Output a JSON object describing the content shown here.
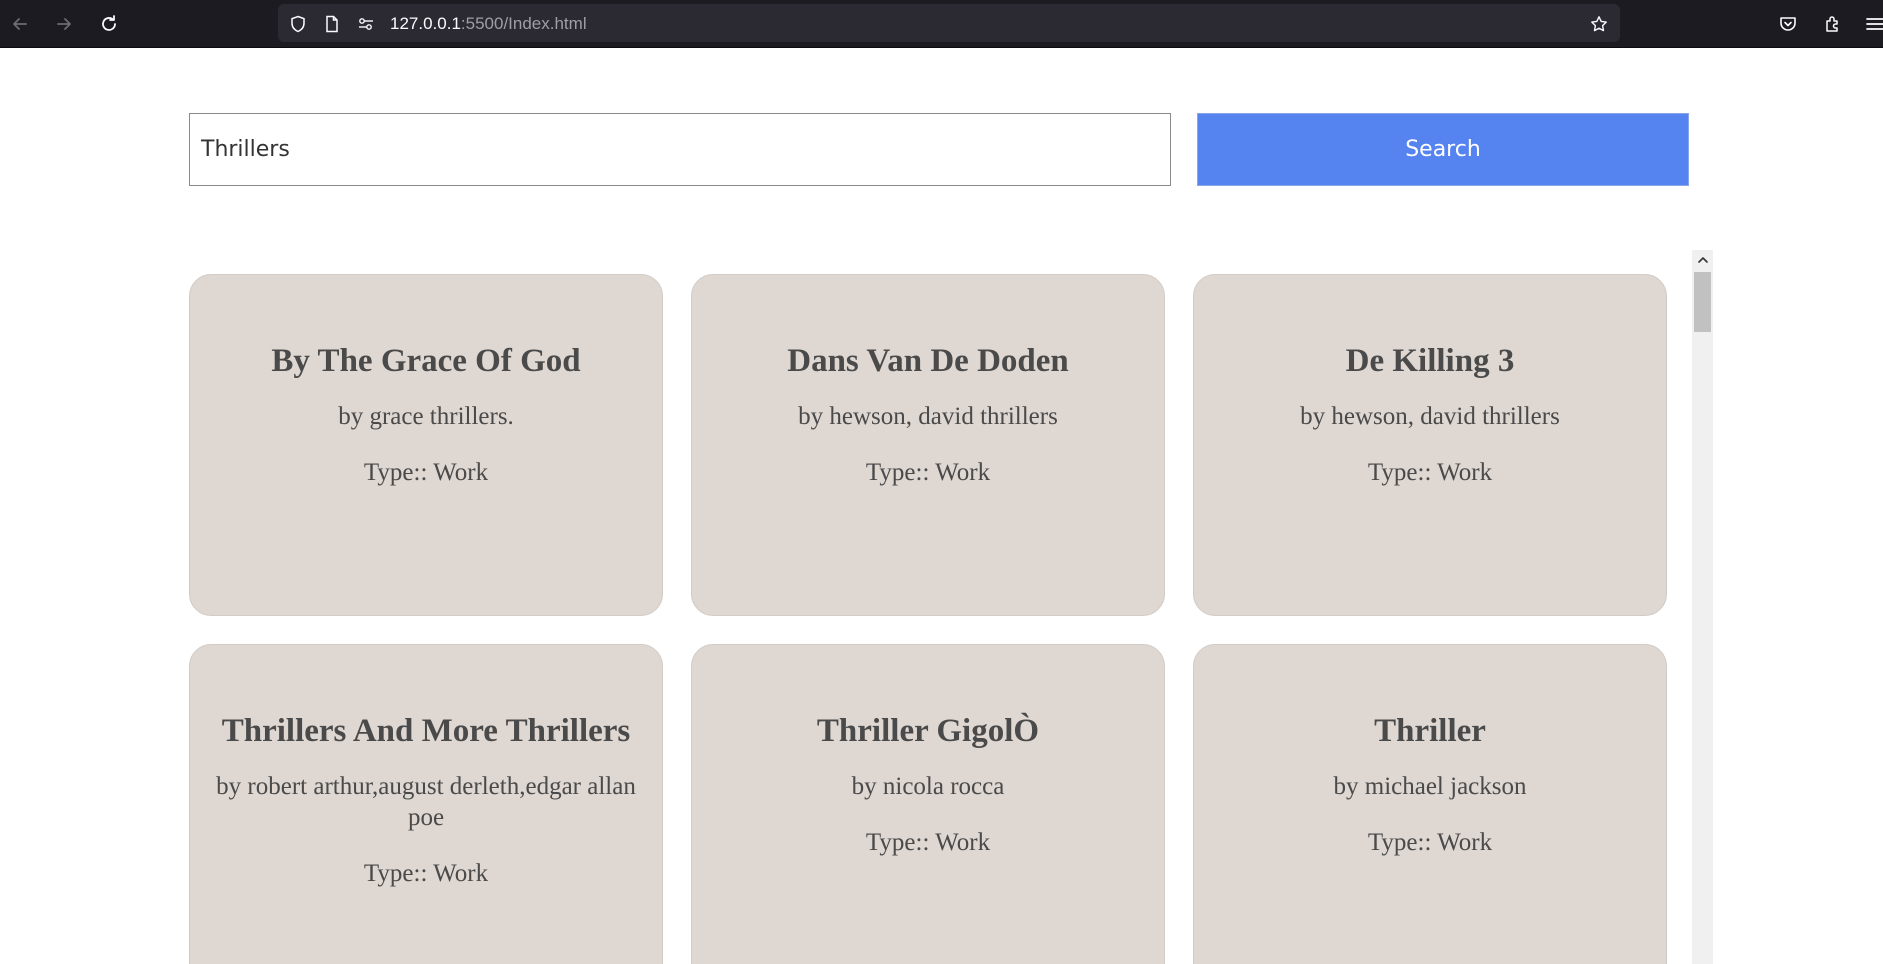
{
  "browser": {
    "url_host": "127.0.0.1",
    "url_path": ":5500/Index.html",
    "icons": [
      "back-arrow-icon",
      "forward-arrow-icon",
      "reload-icon",
      "shield-icon",
      "page-icon",
      "permissions-icon",
      "bookmark-star-icon",
      "pocket-icon",
      "extensions-icon",
      "menu-icon"
    ]
  },
  "search": {
    "value": "Thrillers",
    "button_label": "Search"
  },
  "results": [
    {
      "title": "By The Grace Of God",
      "author": "by grace thrillers.",
      "type": "Type:: Work"
    },
    {
      "title": "Dans Van De Doden",
      "author": "by hewson, david thrillers",
      "type": "Type:: Work"
    },
    {
      "title": "De Killing 3",
      "author": "by hewson, david thrillers",
      "type": "Type:: Work"
    },
    {
      "title": "Thrillers And More Thrillers",
      "author": "by robert arthur,august derleth,edgar allan poe",
      "type": "Type:: Work"
    },
    {
      "title": "Thriller GigolÒ",
      "author": "by nicola rocca",
      "type": "Type:: Work"
    },
    {
      "title": "Thriller",
      "author": "by michael jackson",
      "type": "Type:: Work"
    }
  ],
  "colors": {
    "toolbar_bg": "#1c1b22",
    "urlbar_bg": "#2b2a33",
    "search_button": "#5583f0",
    "card_bg": "#ded7d2",
    "card_text": "#4a4a4a"
  }
}
